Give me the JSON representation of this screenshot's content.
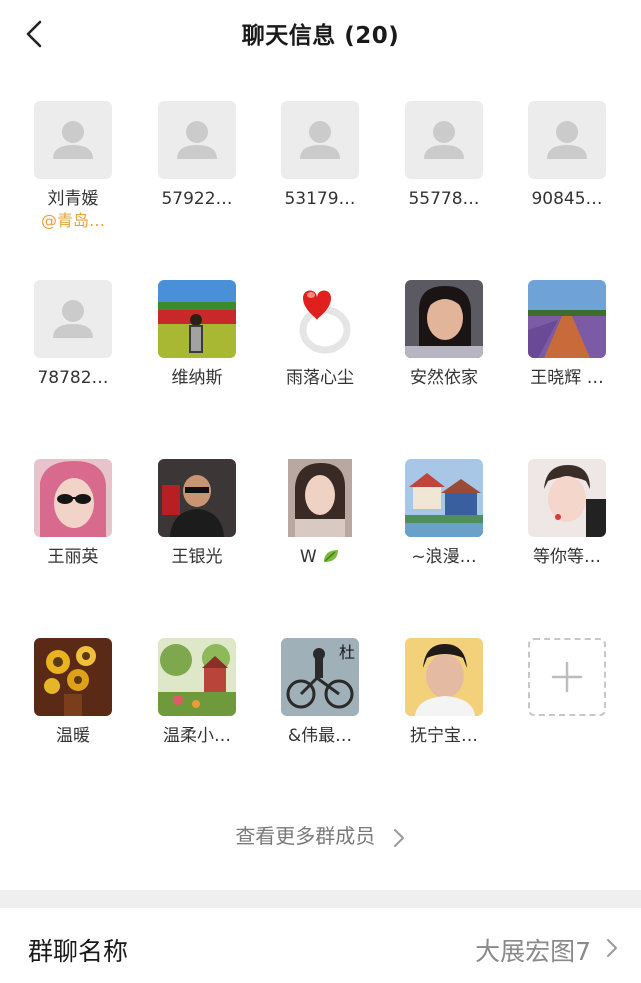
{
  "header": {
    "title": "聊天信息 (20)"
  },
  "members": [
    {
      "name": "刘青媛",
      "tag": "@青岛…",
      "avatar": "default-avatar"
    },
    {
      "name": "57922…",
      "avatar": "default-avatar"
    },
    {
      "name": "53179…",
      "avatar": "default-avatar"
    },
    {
      "name": "55778…",
      "avatar": "default-avatar"
    },
    {
      "name": "90845…",
      "avatar": "default-avatar"
    },
    {
      "name": "78782…",
      "avatar": "default-avatar"
    },
    {
      "name": "维纳斯",
      "avatar": "flower-field-photo"
    },
    {
      "name": "雨落心尘",
      "avatar": "heart-ring-photo"
    },
    {
      "name": "安然依家",
      "avatar": "woman-portrait-photo"
    },
    {
      "name": "王晓辉 …",
      "avatar": "lavender-road-photo"
    },
    {
      "name": "王丽英",
      "avatar": "sunglasses-woman-photo"
    },
    {
      "name": "王银光",
      "avatar": "man-car-photo"
    },
    {
      "name": "W",
      "avatar": "girl-portrait-photo",
      "emoji": "leaf-emoji"
    },
    {
      "name": "~浪漫…",
      "avatar": "seaside-houses-photo"
    },
    {
      "name": "等你等…",
      "avatar": "young-man-photo"
    },
    {
      "name": "温暖",
      "avatar": "sunflowers-painting"
    },
    {
      "name": "温柔小…",
      "avatar": "garden-painting"
    },
    {
      "name": "&伟最…",
      "avatar": "cyclist-photo"
    },
    {
      "name": "抚宁宝…",
      "avatar": "man-portrait-photo"
    }
  ],
  "add_member": {
    "icon": "plus-icon"
  },
  "more_members": {
    "label": "查看更多群成员"
  },
  "group_name_row": {
    "label": "群聊名称",
    "value": "大展宏图7"
  },
  "colors": {
    "tag": "#e6a23c",
    "separator": "#efefef",
    "placeholder_bg": "#ececec",
    "placeholder_fg": "#cbcbcb"
  }
}
